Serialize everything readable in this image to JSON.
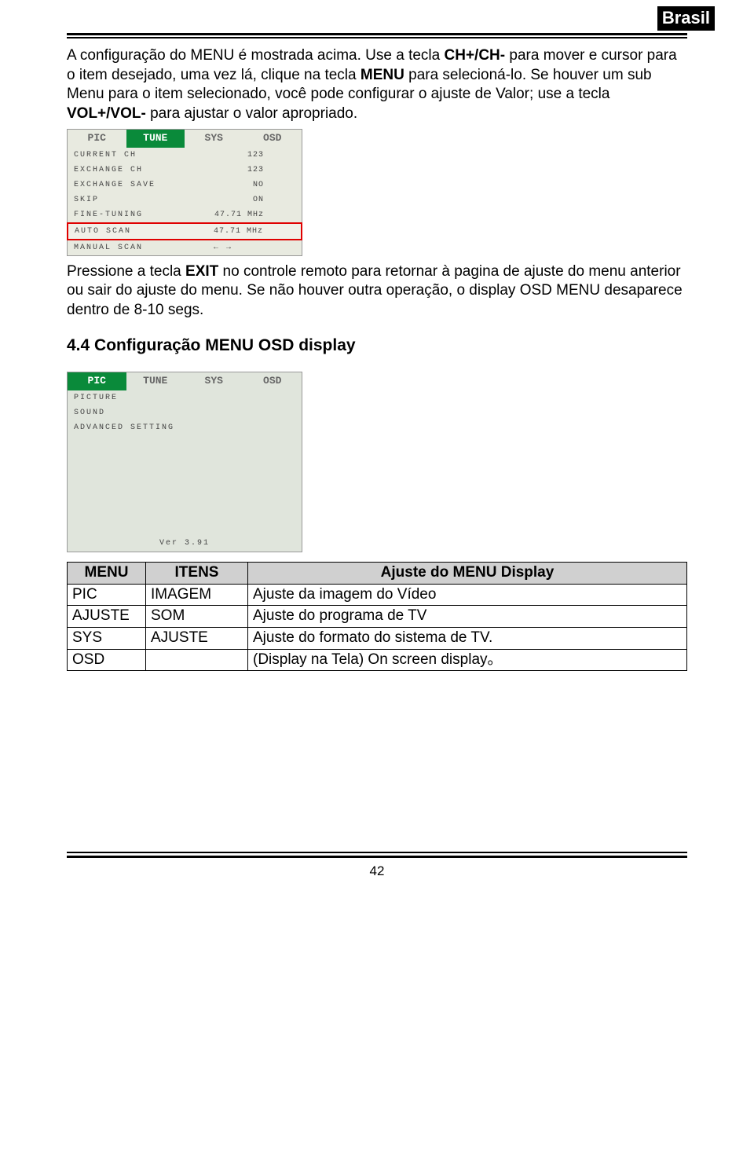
{
  "header": {
    "badge": "Brasil"
  },
  "para1": {
    "t1": "A configuração do MENU é mostrada acima. Use a tecla ",
    "b1": "CH+/CH-",
    "t2": " para mover e cursor para o item desejado, uma vez lá, clique na tecla ",
    "b2": "MENU",
    "t3": " para selecioná-lo. Se houver um sub Menu para o item selecionado, você pode configurar o ajuste de Valor; use a tecla ",
    "b3": "VOL+/VOL-",
    "t4": " para ajustar o valor apropriado."
  },
  "osd1": {
    "tabs": [
      "PIC",
      "TUNE",
      "SYS",
      "OSD"
    ],
    "rows": [
      {
        "label": "CURRENT CH",
        "val": "123"
      },
      {
        "label": "EXCHANGE CH",
        "val": "123"
      },
      {
        "label": "EXCHANGE SAVE",
        "val": "NO"
      },
      {
        "label": "SKIP",
        "val": "ON"
      },
      {
        "label": "FINE-TUNING",
        "val": "47.71 MHz"
      },
      {
        "label": "AUTO SCAN",
        "val": "47.71 MHz"
      },
      {
        "label": "MANUAL SCAN",
        "val": "← →"
      }
    ],
    "highlightIndex": 5
  },
  "para2": {
    "t1": "Pressione a tecla ",
    "b1": "EXIT",
    "t2": " no controle remoto para retornar à pagina de ajuste do menu anterior ou sair do ajuste do menu. Se não houver outra operação, o display OSD MENU desaparece dentro de 8-10 segs."
  },
  "sectionTitle": "4.4 Configuração MENU OSD display",
  "osd2": {
    "tabs": [
      "PIC",
      "TUNE",
      "SYS",
      "OSD"
    ],
    "rows": [
      {
        "label": "PICTURE"
      },
      {
        "label": "SOUND"
      },
      {
        "label": "ADVANCED SETTING"
      }
    ],
    "ver": "Ver 3.91"
  },
  "table": {
    "headers": [
      "MENU",
      "ITENS",
      "Ajuste do MENU Display"
    ],
    "rows": [
      [
        "PIC",
        "IMAGEM",
        "Ajuste da imagem do Vídeo"
      ],
      [
        "AJUSTE",
        "SOM",
        "Ajuste do programa de TV"
      ],
      [
        "SYS",
        "AJUSTE",
        "Ajuste do formato do sistema de TV."
      ],
      [
        "OSD",
        "",
        "(Display na Tela) On screen display。"
      ]
    ]
  },
  "pageNumber": "42"
}
